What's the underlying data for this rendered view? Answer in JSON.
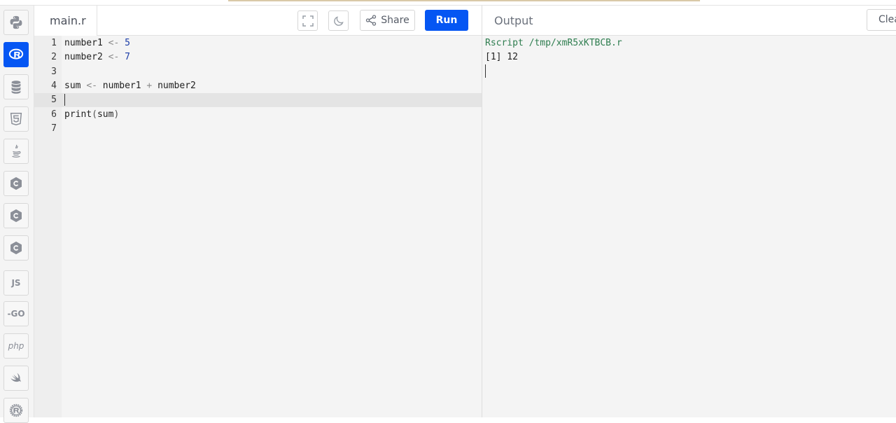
{
  "sidebar": {
    "items": [
      {
        "name": "python",
        "icon": "python-icon",
        "active": false
      },
      {
        "name": "r",
        "icon": "r-icon",
        "active": true
      },
      {
        "name": "sql",
        "icon": "database-icon",
        "active": false
      },
      {
        "name": "html",
        "icon": "html5-icon",
        "active": false
      },
      {
        "name": "java",
        "icon": "java-icon",
        "active": false
      },
      {
        "name": "c",
        "icon": "c-icon",
        "active": false
      },
      {
        "name": "cpp",
        "icon": "cpp-icon",
        "active": false
      },
      {
        "name": "csharp",
        "icon": "csharp-icon",
        "active": false
      },
      {
        "name": "js",
        "label": "JS",
        "icon": "javascript-icon",
        "active": false
      },
      {
        "name": "go",
        "label": "-GO",
        "icon": "go-icon",
        "active": false
      },
      {
        "name": "php",
        "label": "php",
        "icon": "php-icon",
        "active": false
      },
      {
        "name": "swift",
        "icon": "swift-icon",
        "active": false
      },
      {
        "name": "rust",
        "icon": "rust-icon",
        "active": false
      }
    ]
  },
  "editor": {
    "file_tab": "main.r",
    "share_label": "Share",
    "run_label": "Run",
    "line_numbers": [
      "1",
      "2",
      "3",
      "4",
      "5",
      "6",
      "7"
    ],
    "lines": [
      [
        {
          "t": "number1 ",
          "k": "id"
        },
        {
          "t": "<-",
          "k": "op"
        },
        {
          "t": " ",
          "k": "id"
        },
        {
          "t": "5",
          "k": "num"
        }
      ],
      [
        {
          "t": "number2 ",
          "k": "id"
        },
        {
          "t": "<-",
          "k": "op"
        },
        {
          "t": " ",
          "k": "id"
        },
        {
          "t": "7",
          "k": "num"
        }
      ],
      [],
      [
        {
          "t": "sum ",
          "k": "id"
        },
        {
          "t": "<-",
          "k": "op"
        },
        {
          "t": " number1 ",
          "k": "id"
        },
        {
          "t": "+",
          "k": "op"
        },
        {
          "t": " number2",
          "k": "id"
        }
      ],
      [],
      [
        {
          "t": "print",
          "k": "id"
        },
        {
          "t": "(",
          "k": "paren"
        },
        {
          "t": "sum",
          "k": "id"
        },
        {
          "t": ")",
          "k": "paren"
        }
      ],
      []
    ]
  },
  "output": {
    "title": "Output",
    "clear_label": "Clear",
    "lines": [
      {
        "text": "Rscript /tmp/xmR5xKTBCB.r",
        "color": "#2e7d4f"
      },
      {
        "text": "[1] 12",
        "color": "#222222"
      }
    ]
  },
  "colors": {
    "accent": "#0556f3",
    "command_text": "#2e7d4f"
  }
}
